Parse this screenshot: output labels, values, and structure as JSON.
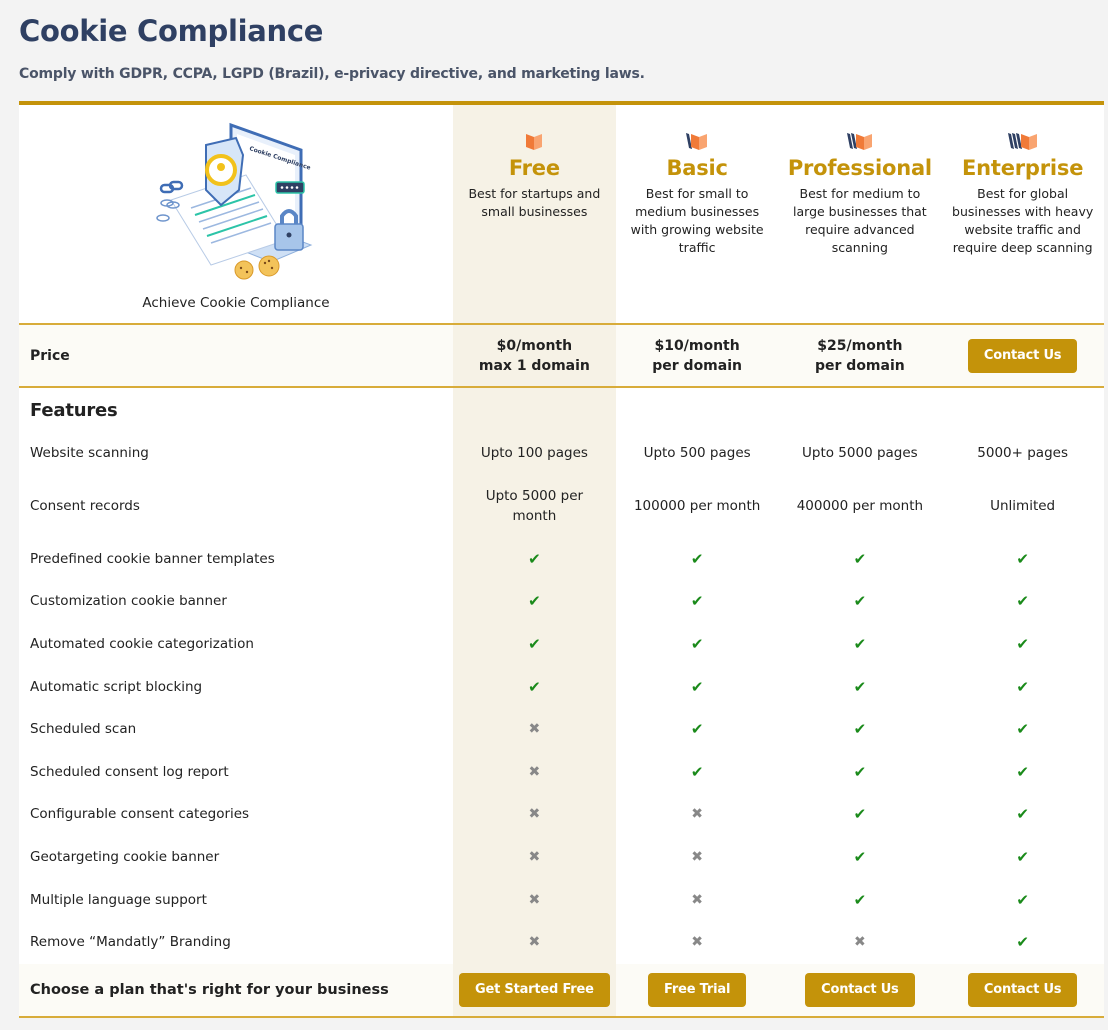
{
  "page": {
    "title": "Cookie Compliance",
    "subtitle": "Comply with GDPR, CCPA, LGPD (Brazil), e-privacy directive, and marketing laws."
  },
  "colors": {
    "accent": "#c4930a",
    "title": "#2f4063",
    "highlight_column": "#f6f2e6",
    "check": "#1a8a1a",
    "cross": "#888888",
    "plan_icon_orange": "#f07a38",
    "plan_icon_navy": "#2f4063"
  },
  "hero": {
    "illustration": "cookie-compliance-illustration",
    "caption": "Achieve Cookie Compliance"
  },
  "plans": [
    {
      "name": "Free",
      "icon": "book-icon-1",
      "description": "Best for startups and small businesses",
      "price_line1": "$0/month",
      "price_line2": "max 1 domain",
      "price_button": null,
      "cta_label": "Get Started Free"
    },
    {
      "name": "Basic",
      "icon": "book-icon-2",
      "description": "Best for small to medium businesses with growing website traffic",
      "price_line1": "$10/month",
      "price_line2": "per domain",
      "price_button": null,
      "cta_label": "Free Trial"
    },
    {
      "name": "Professional",
      "icon": "book-icon-3",
      "description": "Best for medium to large businesses that require advanced scanning",
      "price_line1": "$25/month",
      "price_line2": "per domain",
      "price_button": null,
      "cta_label": "Contact Us"
    },
    {
      "name": "Enterprise",
      "icon": "book-icon-4",
      "description": "Best for global businesses with heavy website traffic and require deep scanning",
      "price_line1": null,
      "price_line2": null,
      "price_button": "Contact Us",
      "cta_label": "Contact Us"
    }
  ],
  "price_label": "Price",
  "features_title": "Features",
  "features": [
    {
      "label": "Website scanning",
      "values": [
        "Upto 100 pages",
        "Upto 500 pages",
        "Upto 5000 pages",
        "5000+ pages"
      ]
    },
    {
      "label": "Consent records",
      "values": [
        "Upto 5000 per month",
        "100000 per month",
        "400000 per month",
        "Unlimited"
      ]
    },
    {
      "label": "Predefined cookie banner templates",
      "values": [
        "check",
        "check",
        "check",
        "check"
      ]
    },
    {
      "label": "Customization cookie banner",
      "values": [
        "check",
        "check",
        "check",
        "check"
      ]
    },
    {
      "label": "Automated cookie categorization",
      "values": [
        "check",
        "check",
        "check",
        "check"
      ]
    },
    {
      "label": "Automatic script blocking",
      "values": [
        "check",
        "check",
        "check",
        "check"
      ]
    },
    {
      "label": "Scheduled scan",
      "values": [
        "cross",
        "check",
        "check",
        "check"
      ]
    },
    {
      "label": "Scheduled consent log report",
      "values": [
        "cross",
        "check",
        "check",
        "check"
      ]
    },
    {
      "label": "Configurable consent categories",
      "values": [
        "cross",
        "cross",
        "check",
        "check"
      ]
    },
    {
      "label": "Geotargeting cookie banner",
      "values": [
        "cross",
        "cross",
        "check",
        "check"
      ]
    },
    {
      "label": "Multiple language support",
      "values": [
        "cross",
        "cross",
        "check",
        "check"
      ]
    },
    {
      "label": "Remove “Mandatly” Branding",
      "values": [
        "cross",
        "cross",
        "cross",
        "check"
      ]
    }
  ],
  "cta_label": "Choose a plan that's right for your business"
}
